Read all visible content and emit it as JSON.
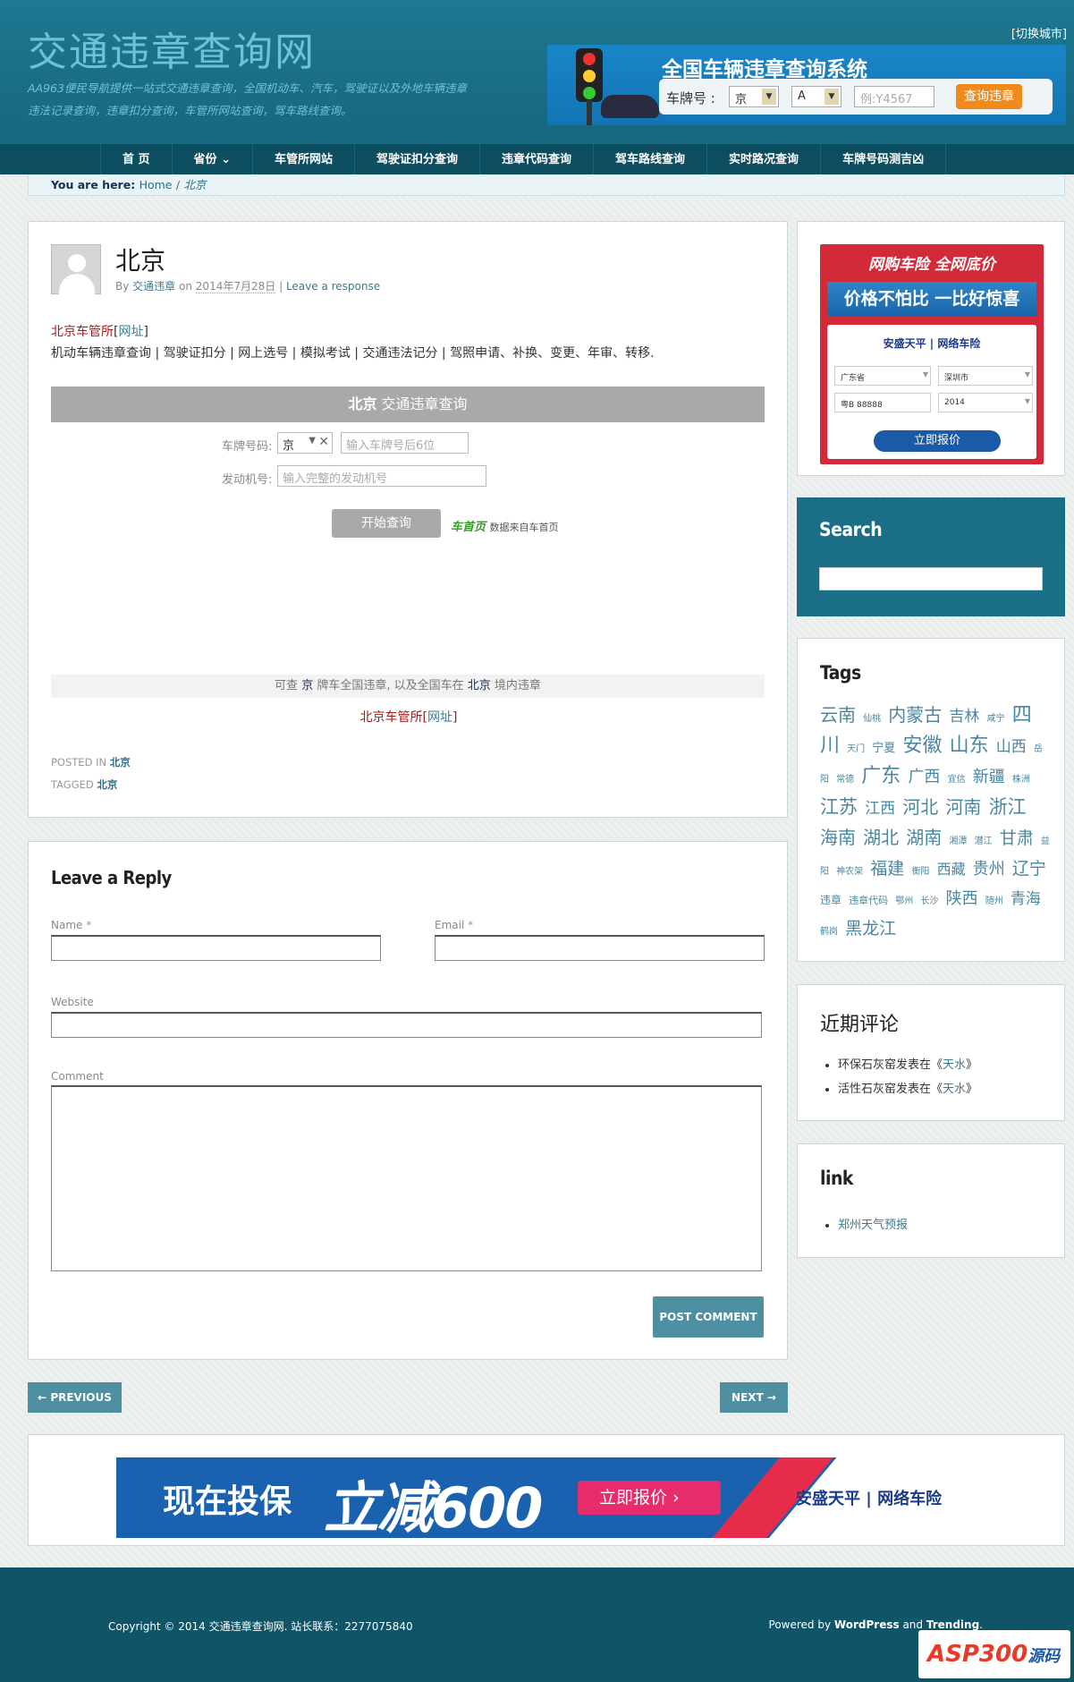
{
  "header": {
    "site_title": "交通违章查询网",
    "site_desc": "AA963便民导航提供一站式交通违章查询，全国机动车、汽车，驾驶证以及外地车辆违章违法记录查询，违章扣分查询，车管所网站查询，驾车路线查询。",
    "switch_city": "[切换城市]",
    "banner": {
      "title": "全国车辆违章查询系统",
      "plate_label": "车牌号 :",
      "province": "京",
      "letter": "A",
      "placeholder": "例:Y4567",
      "button": "查询违章"
    }
  },
  "nav": {
    "items": [
      "首 页",
      "省份",
      "车管所网站",
      "驾驶证扣分查询",
      "违章代码查询",
      "驾车路线查询",
      "实时路况查询",
      "车牌号码测吉凶"
    ]
  },
  "breadcrumb": {
    "label": "You are here:",
    "home": "Home",
    "sep": "/",
    "current": "北京"
  },
  "post": {
    "title": "北京",
    "by": "By",
    "author": "交通违章",
    "on": "on",
    "date": "2014年7月28日",
    "sep": "|",
    "response": "Leave a response",
    "dmv_name": "北京车管所",
    "dmv_link": "网址",
    "services": "机动车辆违章查询 | 驾驶证扣分 | 网上选号 | 模拟考试 | 交通违法记分 | 驾照申请、补换、变更、年审、转移.",
    "query_city": "北京",
    "query_title": "交通违章查询",
    "plate_label": "车牌号码:",
    "plate_prefix": "京",
    "plate_placeholder": "输入车牌号后6位",
    "engine_label": "发动机号:",
    "engine_placeholder": "输入完整的发动机号",
    "start_button": "开始查询",
    "source_logo": "车首页",
    "source_text": "数据来自车首页",
    "foot_pre": "可查",
    "foot_plate": "京",
    "foot_mid": "牌车全国违章, 以及全国车在",
    "foot_city": "北京",
    "foot_post": "境内违章",
    "posted_in_label": "POSTED IN",
    "posted_in": "北京",
    "tagged_label": "TAGGED",
    "tagged": "北京"
  },
  "reply": {
    "title": "Leave a Reply",
    "name_label": "Name",
    "email_label": "Email",
    "required": "*",
    "website_label": "Website",
    "comment_label": "Comment",
    "submit": "POST COMMENT"
  },
  "pagination": {
    "prev": "← PREVIOUS",
    "next": "NEXT →"
  },
  "sidebar": {
    "ad": {
      "top": "网购车险 全网底价",
      "mid": "价格不怕比 一比好惊喜",
      "brand": "安盛天平 | 网络车险",
      "sel1": "广东省",
      "sel2": "深圳市",
      "sel3": "粤B 88888",
      "sel4": "2014",
      "button": "立即报价"
    },
    "search_title": "Search",
    "tags_title": "Tags",
    "tags": [
      {
        "t": "云南",
        "s": 20
      },
      {
        "t": "仙桃",
        "s": 10
      },
      {
        "t": "内蒙古",
        "s": 20
      },
      {
        "t": "吉林",
        "s": 17
      },
      {
        "t": "咸宁",
        "s": 10
      },
      {
        "t": "四川",
        "s": 22
      },
      {
        "t": "天门",
        "s": 10
      },
      {
        "t": "宁夏",
        "s": 13
      },
      {
        "t": "安徽",
        "s": 22
      },
      {
        "t": "山东",
        "s": 22
      },
      {
        "t": "山西",
        "s": 17
      },
      {
        "t": "岳阳",
        "s": 10
      },
      {
        "t": "常德",
        "s": 10
      },
      {
        "t": "广东",
        "s": 22
      },
      {
        "t": "广西",
        "s": 18
      },
      {
        "t": "宜信",
        "s": 10
      },
      {
        "t": "新疆",
        "s": 18
      },
      {
        "t": "株洲",
        "s": 10
      },
      {
        "t": "江苏",
        "s": 21
      },
      {
        "t": "江西",
        "s": 17
      },
      {
        "t": "河北",
        "s": 20
      },
      {
        "t": "河南",
        "s": 20
      },
      {
        "t": "浙江",
        "s": 21
      },
      {
        "t": "海南",
        "s": 20
      },
      {
        "t": "湖北",
        "s": 20
      },
      {
        "t": "湖南",
        "s": 20
      },
      {
        "t": "湘潭",
        "s": 10
      },
      {
        "t": "潜江",
        "s": 10
      },
      {
        "t": "甘肃",
        "s": 19
      },
      {
        "t": "益阳",
        "s": 10
      },
      {
        "t": "神农架",
        "s": 10
      },
      {
        "t": "福建",
        "s": 19
      },
      {
        "t": "衡阳",
        "s": 10
      },
      {
        "t": "西藏",
        "s": 16
      },
      {
        "t": "贵州",
        "s": 18
      },
      {
        "t": "辽宁",
        "s": 19
      },
      {
        "t": "违章",
        "s": 12
      },
      {
        "t": "违章代码",
        "s": 11
      },
      {
        "t": "鄂州",
        "s": 10
      },
      {
        "t": "长沙",
        "s": 10
      },
      {
        "t": "陕西",
        "s": 18
      },
      {
        "t": "随州",
        "s": 10
      },
      {
        "t": "青海",
        "s": 17
      },
      {
        "t": "鹤岗",
        "s": 10
      },
      {
        "t": "黑龙江",
        "s": 19
      }
    ],
    "recent_title": "近期评论",
    "recent": [
      {
        "who": "环保石灰窑",
        "mid": "发表在《",
        "post": "天水",
        "end": "》"
      },
      {
        "who": "活性石灰窑",
        "mid": "发表在《",
        "post": "天水",
        "end": "》"
      }
    ],
    "link_title": "link",
    "links": [
      "郑州天气预报"
    ]
  },
  "bottom_ad": {
    "t1": "现在投保",
    "t2": "立减600",
    "button": "立即报价",
    "brand": "安盛天平 | 网络车险"
  },
  "footer": {
    "copyright": "Copyright © 2014 交通违章查询网. 站长联系：2277075840",
    "powered_pre": "Powered by",
    "wordpress": "WordPress",
    "and": "and",
    "trending": "Trending",
    "dot": ".",
    "watermark": "ASP300",
    "watermark2": "源码"
  },
  "colors": {
    "header_bg": "#1a6e85",
    "nav_bg": "#0d4d60",
    "accent": "#4e8fa2",
    "dmv_red": "#9c1c1c"
  }
}
